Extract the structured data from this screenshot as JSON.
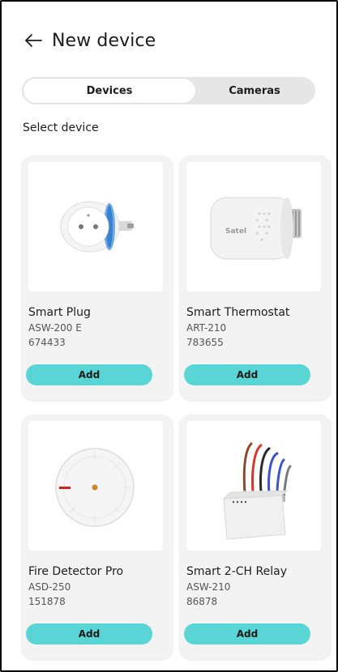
{
  "header": {
    "title": "New device",
    "back_icon": "arrow-left-icon"
  },
  "tabs": [
    {
      "label": "Devices",
      "active": true
    },
    {
      "label": "Cameras",
      "active": false
    }
  ],
  "section_label": "Select device",
  "devices": [
    {
      "name": "Smart Plug",
      "model": "ASW-200 E",
      "code": "674433",
      "add_label": "Add",
      "image": "smart-plug-image"
    },
    {
      "name": "Smart Thermostat",
      "model": "ART-210",
      "code": "783655",
      "add_label": "Add",
      "image": "smart-thermostat-image",
      "brand_text": "Satel"
    },
    {
      "name": "Fire Detector Pro",
      "model": "ASD-250",
      "code": "151878",
      "add_label": "Add",
      "image": "fire-detector-image"
    },
    {
      "name": "Smart 2-CH Relay",
      "model": "ASW-210",
      "code": "86878",
      "add_label": "Add",
      "image": "relay-module-image"
    }
  ],
  "colors": {
    "accent": "#5ad5d5",
    "card_bg": "#f3f3f3",
    "tab_track": "#e6e6e6"
  }
}
